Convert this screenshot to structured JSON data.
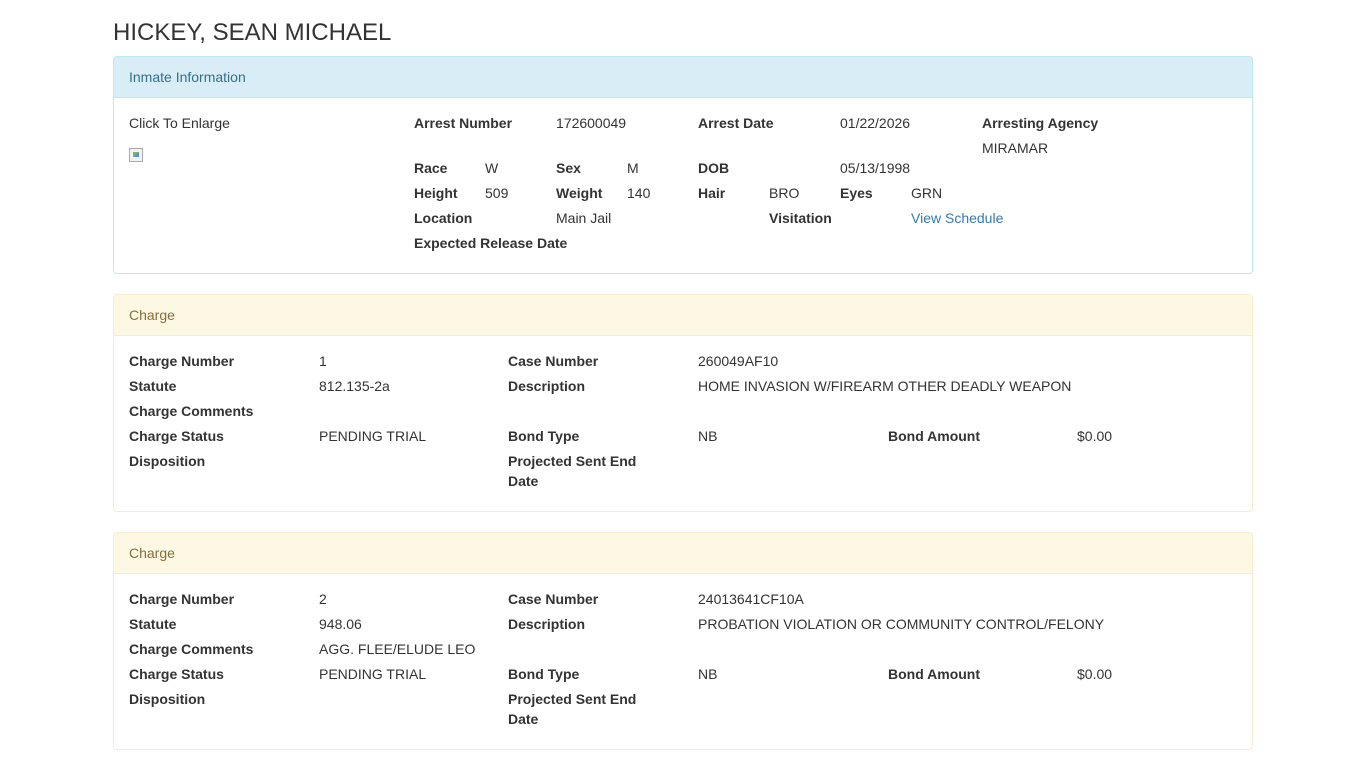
{
  "inmate": {
    "name": "HICKEY, SEAN MICHAEL",
    "panel_title": "Inmate Information",
    "photo_label": "Click To Enlarge",
    "fields": {
      "arrest_number_label": "Arrest Number",
      "arrest_number": "172600049",
      "arrest_date_label": "Arrest Date",
      "arrest_date": "01/22/2026",
      "arresting_agency_label": "Arresting Agency",
      "arresting_agency": "MIRAMAR",
      "race_label": "Race",
      "race": "W",
      "sex_label": "Sex",
      "sex": "M",
      "dob_label": "DOB",
      "dob": "05/13/1998",
      "height_label": "Height",
      "height": "509",
      "weight_label": "Weight",
      "weight": "140",
      "hair_label": "Hair",
      "hair": "BRO",
      "eyes_label": "Eyes",
      "eyes": "GRN",
      "location_label": "Location",
      "location": "Main Jail",
      "visitation_label": "Visitation",
      "visitation_link": "View Schedule",
      "expected_release_label": "Expected Release Date"
    }
  },
  "labels": {
    "panel_title": "Charge",
    "charge_number": "Charge Number",
    "case_number": "Case Number",
    "statute": "Statute",
    "description": "Description",
    "charge_comments": "Charge Comments",
    "charge_status": "Charge Status",
    "bond_type": "Bond Type",
    "bond_amount": "Bond Amount",
    "disposition": "Disposition",
    "projected_sent_end_date": "Projected Sent End Date"
  },
  "charges": [
    {
      "charge_number": "1",
      "case_number": "260049AF10",
      "statute": "812.135-2a",
      "description": "HOME INVASION W/FIREARM OTHER DEADLY WEAPON",
      "charge_comments": "",
      "charge_status": "PENDING TRIAL",
      "bond_type": "NB",
      "bond_amount": "$0.00",
      "disposition": "",
      "projected_sent_end_date": ""
    },
    {
      "charge_number": "2",
      "case_number": "24013641CF10A",
      "statute": "948.06",
      "description": "PROBATION VIOLATION OR COMMUNITY CONTROL/FELONY",
      "charge_comments": "AGG. FLEE/ELUDE LEO",
      "charge_status": "PENDING TRIAL",
      "bond_type": "NB",
      "bond_amount": "$0.00",
      "disposition": "",
      "projected_sent_end_date": ""
    }
  ]
}
